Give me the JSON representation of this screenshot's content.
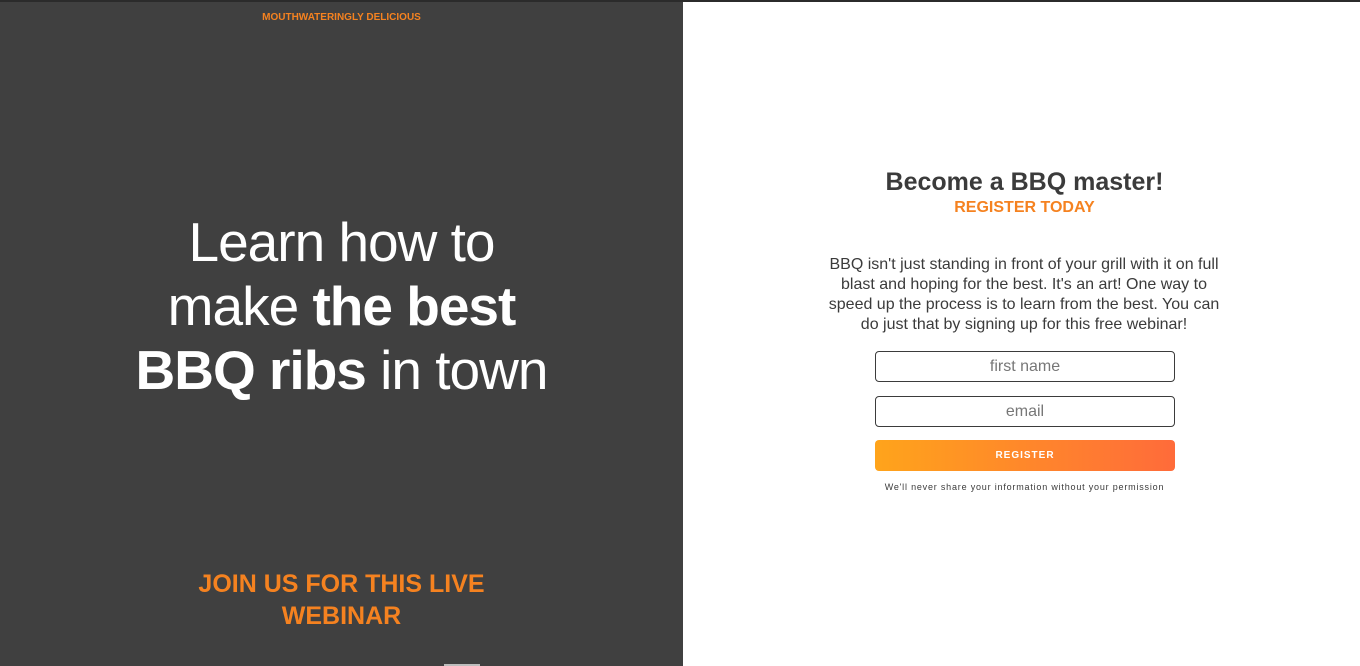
{
  "hero": {
    "eyebrow": "MOUTHWATERINGLY DELICIOUS",
    "headline_line1": "Learn how to",
    "headline_line2_plain": "make ",
    "headline_line2_bold": "the best",
    "headline_line3_bold": "BBQ ribs",
    "headline_line3_plain": " in town",
    "cta_line1": "JOIN US FOR THIS LIVE",
    "cta_line2": "WEBINAR"
  },
  "form": {
    "title": "Become a BBQ master!",
    "subtitle": "REGISTER TODAY",
    "description": "BBQ isn't just standing in front of your grill with it on full blast and hoping for the best. It's an art! One way to speed up the process is to learn from the best. You can do just that by signing up for this free webinar!",
    "first_name_placeholder": "first name",
    "email_placeholder": "email",
    "register_label": "REGISTER",
    "privacy_note": "We'll never share your information without your permission"
  },
  "colors": {
    "accent": "#f58220",
    "left_bg": "#404040",
    "button_gradient_start": "#ffa41b",
    "button_gradient_end": "#ff6b3a"
  }
}
